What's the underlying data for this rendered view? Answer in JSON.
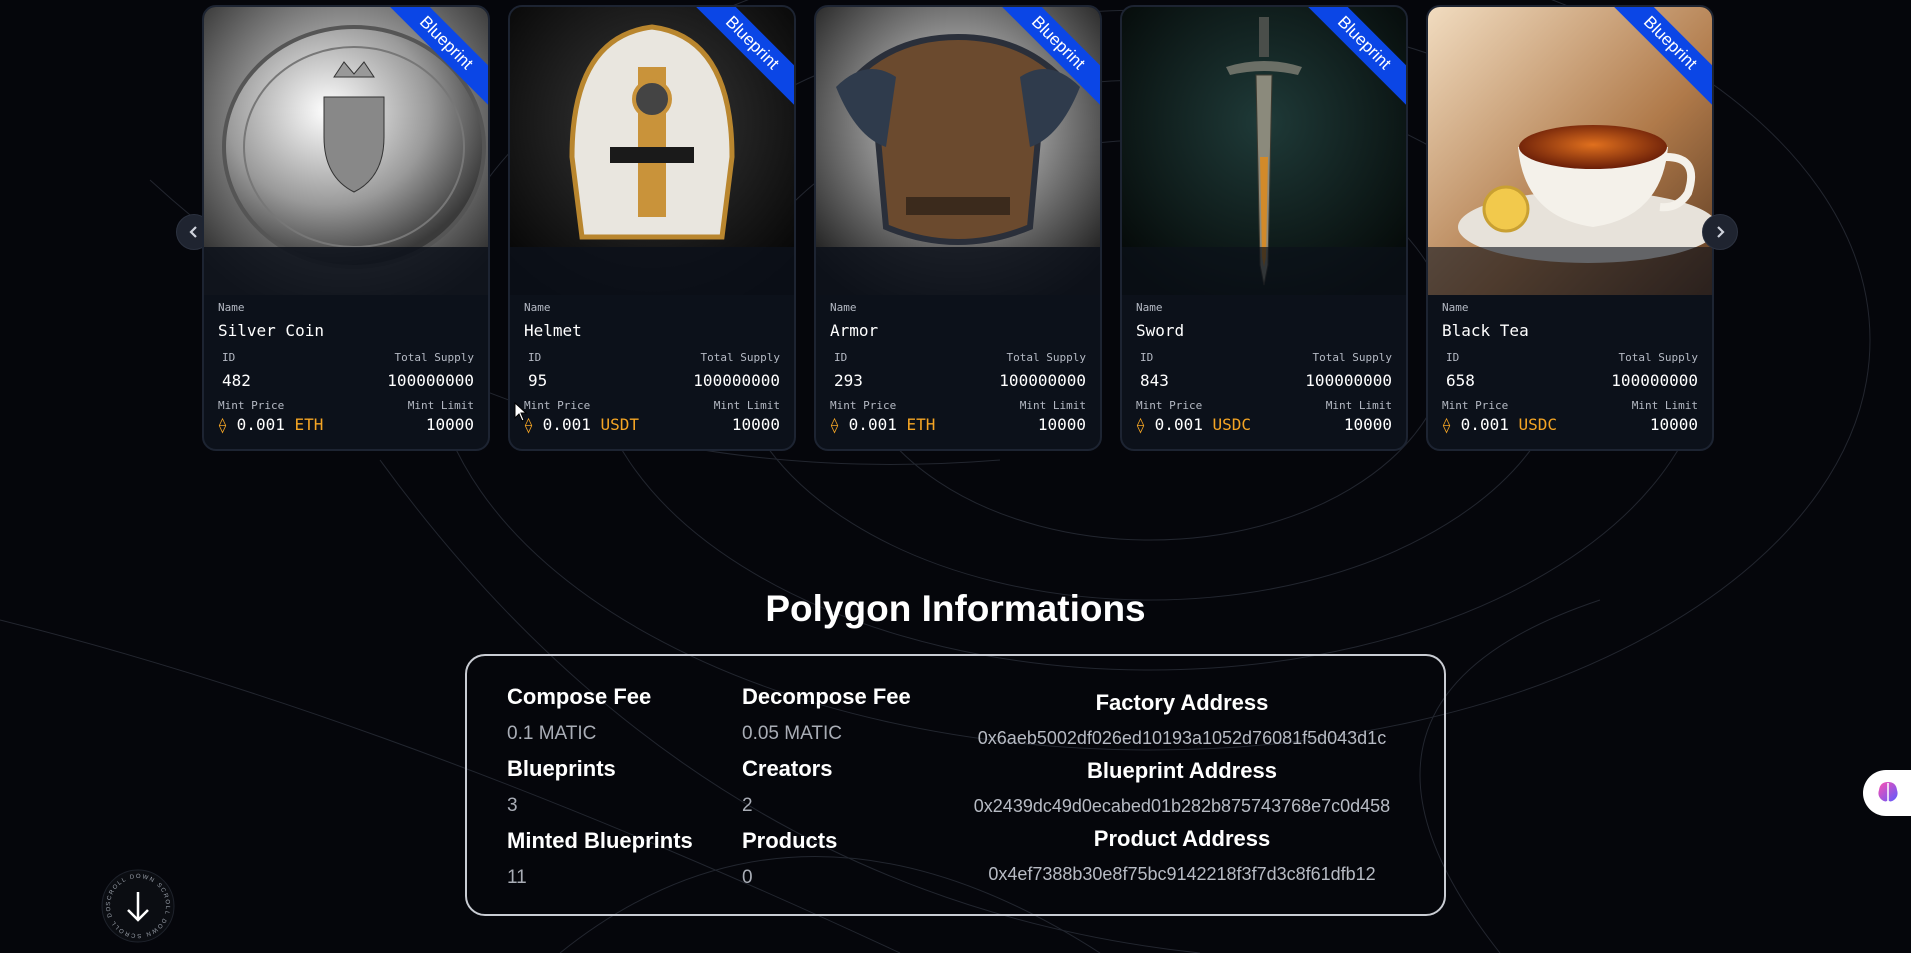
{
  "carousel": {
    "ribbon_label": "Blueprint",
    "prev_icon": "chevron-left-icon",
    "next_icon": "chevron-right-icon",
    "field_labels": {
      "name": "Name",
      "id": "ID",
      "total_supply": "Total Supply",
      "mint_price": "Mint Price",
      "mint_limit": "Mint Limit"
    },
    "cards": [
      {
        "name": "Silver Coin",
        "id": "482",
        "total_supply": "100000000",
        "price": "0.001",
        "currency": "ETH",
        "mint_limit": "10000",
        "image": "silver-coin-image"
      },
      {
        "name": "Helmet",
        "id": "95",
        "total_supply": "100000000",
        "price": "0.001",
        "currency": "USDT",
        "mint_limit": "10000",
        "image": "helmet-image"
      },
      {
        "name": "Armor",
        "id": "293",
        "total_supply": "100000000",
        "price": "0.001",
        "currency": "ETH",
        "mint_limit": "10000",
        "image": "armor-image"
      },
      {
        "name": "Sword",
        "id": "843",
        "total_supply": "100000000",
        "price": "0.001",
        "currency": "USDC",
        "mint_limit": "10000",
        "image": "sword-image"
      },
      {
        "name": "Black Tea",
        "id": "658",
        "total_supply": "100000000",
        "price": "0.001",
        "currency": "USDC",
        "mint_limit": "10000",
        "image": "black-tea-image"
      }
    ]
  },
  "polygon": {
    "title": "Polygon Informations",
    "compose_fee_label": "Compose Fee",
    "compose_fee_value": "0.1 MATIC",
    "decompose_fee_label": "Decompose Fee",
    "decompose_fee_value": "0.05 MATIC",
    "blueprints_label": "Blueprints",
    "blueprints_value": "3",
    "creators_label": "Creators",
    "creators_value": "2",
    "minted_label": "Minted Blueprints",
    "minted_value": "11",
    "products_label": "Products",
    "products_value": "0",
    "factory_label": "Factory Address",
    "factory_value": "0x6aeb5002df026ed10193a1052d76081f5d043d1c",
    "blueprint_addr_label": "Blueprint Address",
    "blueprint_addr_value": "0x2439dc49d0ecabed01b282b875743768e7c0d458",
    "product_addr_label": "Product Address",
    "product_addr_value": "0x4ef7388b30e8f75bc9142218f3f7d3c8f61dfb12"
  },
  "scroll": {
    "ring_text": "SCROLL DOWN SCROLL DOWN SCROLL DOWN",
    "icon": "arrow-down-icon"
  },
  "side_widget": {
    "icon": "brain-icon"
  },
  "colors": {
    "background": "#05060b",
    "ribbon": "#0b46e6",
    "currency": "#f5a524",
    "card_border": "#1d2432"
  }
}
